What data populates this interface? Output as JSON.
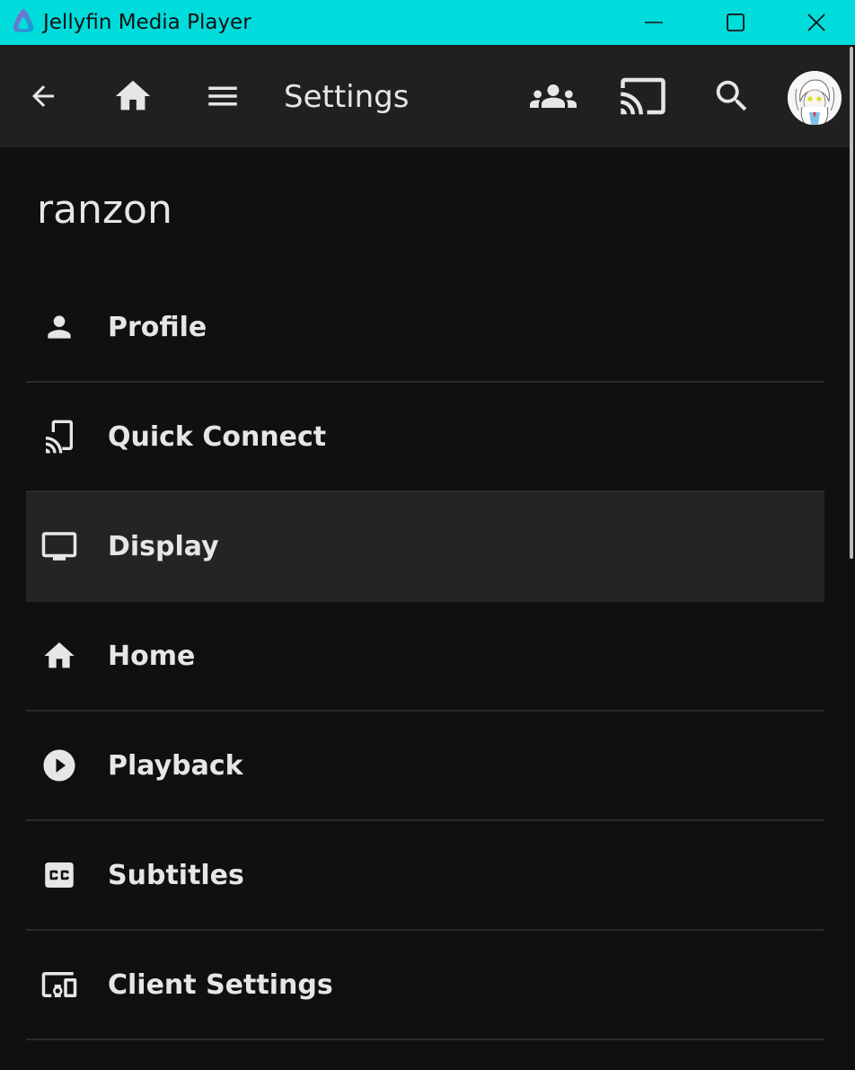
{
  "window": {
    "title": "Jellyfin Media Player",
    "controls": [
      "minimize",
      "maximize",
      "close"
    ]
  },
  "header": {
    "title": "Settings",
    "icons": {
      "back": "arrow-back-icon",
      "home": "home-icon",
      "menu": "hamburger-menu-icon",
      "syncplay": "group-icon",
      "cast": "cast-icon",
      "search": "search-icon",
      "avatar": "user-avatar"
    }
  },
  "user": {
    "name": "ranzon"
  },
  "menu": {
    "items": [
      {
        "label": "Profile",
        "icon": "person-icon",
        "active": false
      },
      {
        "label": "Quick Connect",
        "icon": "phonelink-cast-icon",
        "active": false
      },
      {
        "label": "Display",
        "icon": "monitor-icon",
        "active": true
      },
      {
        "label": "Home",
        "icon": "home-icon",
        "active": false
      },
      {
        "label": "Playback",
        "icon": "play-circle-icon",
        "active": false
      },
      {
        "label": "Subtitles",
        "icon": "closed-caption-icon",
        "active": false
      },
      {
        "label": "Client Settings",
        "icon": "devices-icon",
        "active": false
      }
    ]
  },
  "colors": {
    "titlebar": "#00dcdc",
    "appbar": "#202020",
    "background": "#101010",
    "active_item": "#242424",
    "text": "#e6e6e6"
  }
}
